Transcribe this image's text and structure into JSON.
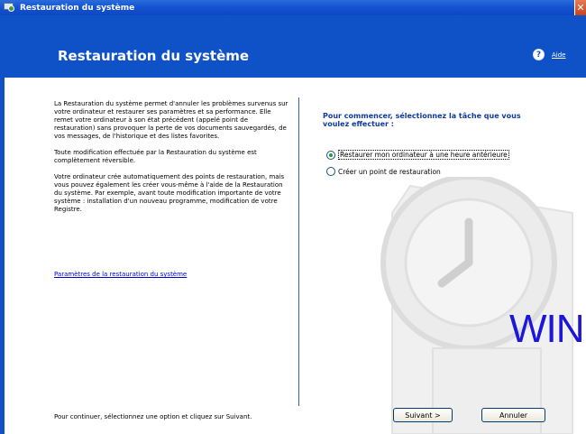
{
  "window": {
    "title": "Restauration du système",
    "close_glyph": "✕"
  },
  "header": {
    "title": "Restauration du système",
    "help_label": "Aide",
    "help_glyph": "?"
  },
  "left": {
    "paragraphs": [
      "La Restauration du système permet d'annuler les problèmes survenus sur votre ordinateur et restaurer ses paramètres et sa performance. Elle remet votre ordinateur à son état précédent (appelé point de restauration) sans provoquer la perte de vos documents sauvegardés, de vos messages, de l'historique et des listes favorites.",
      "Toute modification effectuée par la Restauration du système est complètement réversible.",
      "Votre ordinateur crée automatiquement des points de restauration, mais vous pouvez également les créer vous-même à l'aide de la Restauration du système. Par exemple, avant toute modification importante de votre système : installation d'un nouveau programme, modification de votre Registre."
    ],
    "settings_link": "Paramètres de la restauration du système",
    "footer": "Pour continuer, sélectionnez une option et cliquez sur Suivant."
  },
  "right": {
    "prompt": "Pour commencer, sélectionnez la tâche que vous voulez effectuer :",
    "options": [
      {
        "label": "Restaurer mon ordinateur à une heure antérieure",
        "selected": true
      },
      {
        "label": "Créer un point de restauration",
        "selected": false
      }
    ],
    "watermark_text": "WIND"
  },
  "buttons": {
    "next": "Suivant >",
    "cancel": "Annuler"
  },
  "colors": {
    "header_bg": "#0f52c8",
    "prompt": "#0f3aa0",
    "link": "#0000cc",
    "watermark": "#1b16d8"
  }
}
